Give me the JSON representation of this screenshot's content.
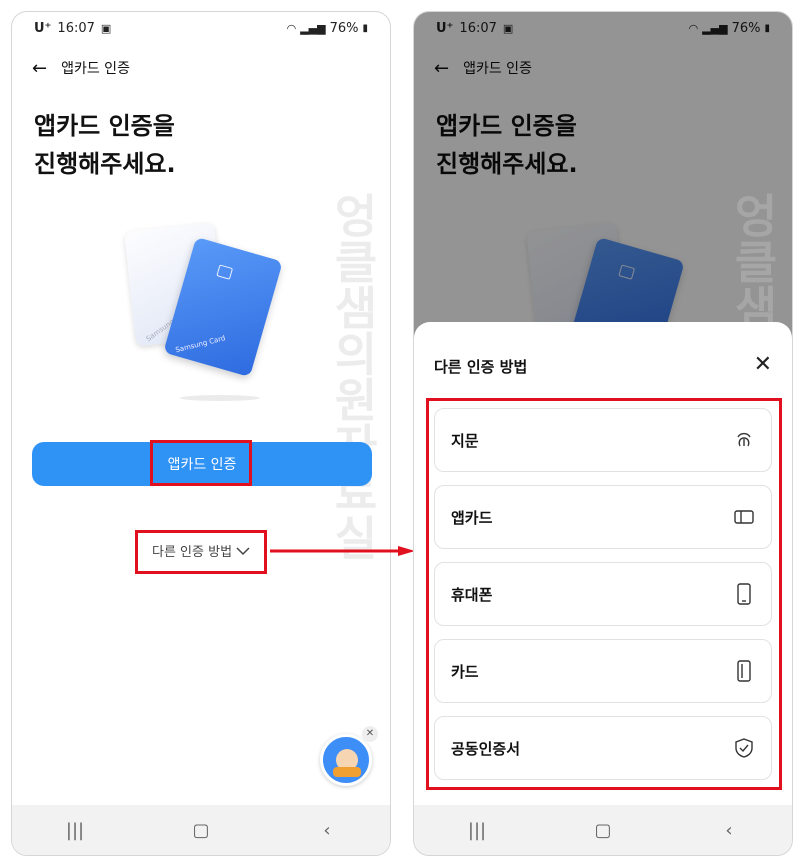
{
  "left": {
    "status": {
      "time": "16:07",
      "carrier": "U⁺",
      "battery": "76%"
    },
    "appbar": {
      "title": "앱카드 인증"
    },
    "heading": {
      "line1": "앱카드 인증을",
      "line2": "진행해주세요."
    },
    "cards": {
      "card1_text": "Samsung Card",
      "card2_text": "Samsung Card"
    },
    "primary_button": "앱카드 인증",
    "other_methods": "다른 인증 방법",
    "watermark": "엉클샘의원자료실"
  },
  "right": {
    "status": {
      "time": "16:07",
      "carrier": "U⁺",
      "battery": "76%"
    },
    "appbar": {
      "title": "앱카드 인증"
    },
    "heading": {
      "line1": "앱카드 인증을",
      "line2": "진행해주세요."
    },
    "sheet": {
      "title": "다른 인증 방법",
      "options": [
        {
          "label": "지문",
          "icon": "fingerprint-icon"
        },
        {
          "label": "앱카드",
          "icon": "appcard-icon"
        },
        {
          "label": "휴대폰",
          "icon": "phone-icon"
        },
        {
          "label": "카드",
          "icon": "card-icon"
        },
        {
          "label": "공동인증서",
          "icon": "shield-check-icon"
        }
      ]
    },
    "watermark": "엉클샘의원자료실"
  },
  "colors": {
    "accent": "#2f92f5",
    "highlight": "#e0101e"
  }
}
